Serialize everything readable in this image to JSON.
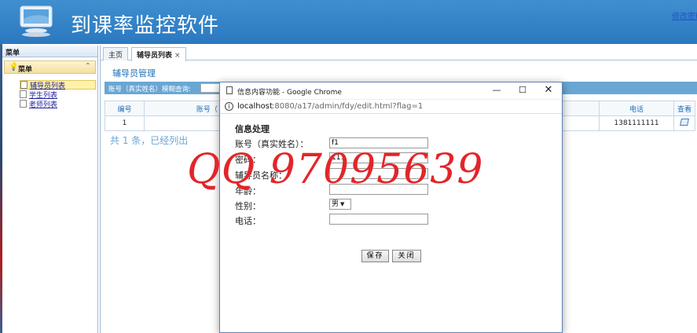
{
  "header": {
    "app_title": "到课率监控软件",
    "top_link": "修改密码"
  },
  "left_menu": {
    "title": "菜单",
    "panel_title": "菜单",
    "items": [
      {
        "label": "辅导员列表",
        "active": true
      },
      {
        "label": "学生列表",
        "active": false
      },
      {
        "label": "老师列表",
        "active": false
      }
    ]
  },
  "tabs": [
    {
      "label": "主页"
    },
    {
      "label": "辅导员列表"
    }
  ],
  "main": {
    "page_title": "辅导员管理",
    "search_label": "账号（真实姓名）模糊查询:",
    "columns": [
      "编号",
      "账号（",
      "电话",
      "查看"
    ],
    "rows": [
      {
        "id": "1",
        "phone": "1381111111"
      }
    ],
    "footer_text": "共 1 条，已经列出"
  },
  "popup": {
    "window_title": "信息内容功能 - Google Chrome",
    "url_host": "localhost",
    "url_path": ":8080/a17/admin/fdy/edit.html?flag=1",
    "form_title": "信息处理",
    "fields": {
      "account_label": "账号（真实姓名）：",
      "account_value": "f1",
      "password_label": "密码：",
      "password_value": "111",
      "name_label": "辅导员名称：",
      "name_value": "",
      "age_label": "年龄：",
      "age_value": "",
      "gender_label": "性别：",
      "gender_value": "男",
      "phone_label": "电话：",
      "phone_value": ""
    },
    "save_label": "保存",
    "close_label": "关闭"
  },
  "watermark": "QQ 97095639",
  "colors": {
    "banner": "#2b78bf",
    "accent": "#1f6fb9",
    "search_bar": "#6aa6d4",
    "watermark": "#e1262a"
  }
}
